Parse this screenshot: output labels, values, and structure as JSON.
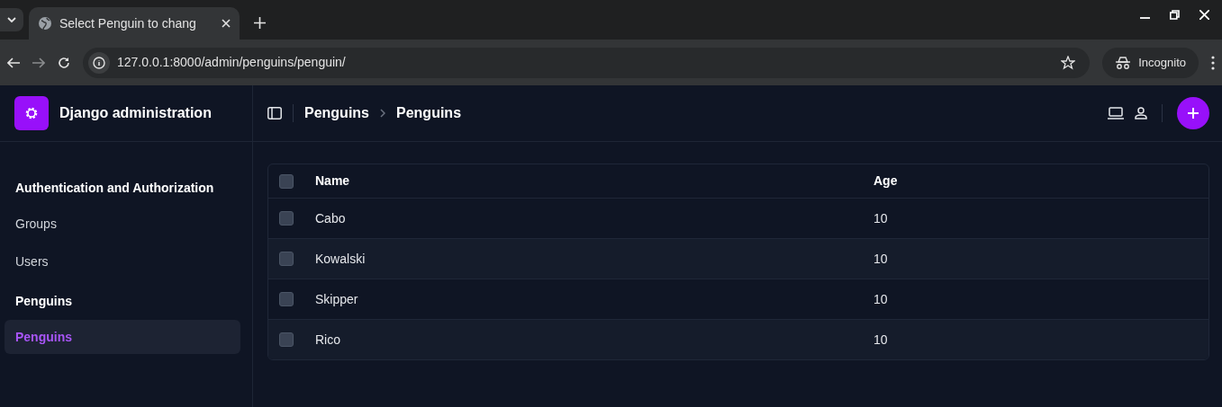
{
  "browser": {
    "tab_title": "Select Penguin to chang",
    "address": "127.0.0.1:8000/admin/penguins/penguin/",
    "profile": "Incognito"
  },
  "brand": "Django administration",
  "breadcrumbs": [
    "Penguins",
    "Penguins"
  ],
  "sidebar": {
    "sections": [
      {
        "title": "Authentication and Authorization",
        "items": [
          {
            "label": "Groups",
            "selected": false
          },
          {
            "label": "Users",
            "selected": false
          }
        ]
      },
      {
        "title": "Penguins",
        "items": [
          {
            "label": "Penguins",
            "selected": true
          }
        ]
      }
    ]
  },
  "table": {
    "select_all": {
      "checked": false
    },
    "columns": [
      "Name",
      "Age"
    ],
    "rows": [
      {
        "name": "Cabo",
        "age": "10",
        "checked": false
      },
      {
        "name": "Kowalski",
        "age": "10",
        "checked": false
      },
      {
        "name": "Skipper",
        "age": "10",
        "checked": false
      },
      {
        "name": "Rico",
        "age": "10",
        "checked": false
      }
    ]
  }
}
